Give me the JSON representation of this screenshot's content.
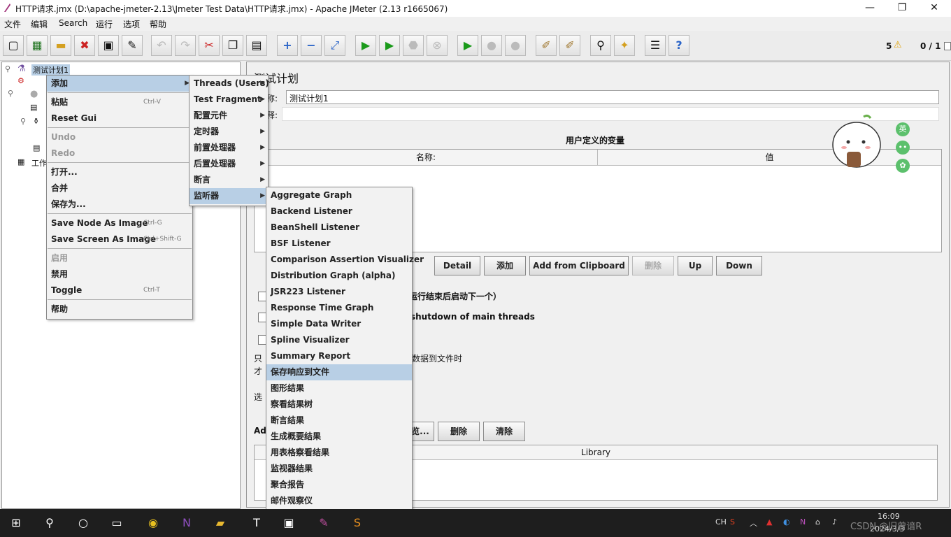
{
  "window": {
    "title": "HTTP请求.jmx (D:\\apache-jmeter-2.13\\Jmeter Test Data\\HTTP请求.jmx) - Apache JMeter (2.13 r1665067)",
    "minimize": "—",
    "maximize": "❐",
    "close": "✕"
  },
  "menubar": [
    "文件",
    "编辑",
    "Search",
    "运行",
    "选项",
    "帮助"
  ],
  "status": {
    "warnings": "5",
    "threads": "0 / 1"
  },
  "tree": {
    "root": "测试计划1",
    "workbench_partial": "工作"
  },
  "context_menu": {
    "items": [
      {
        "label": "添加",
        "shortcut": ""
      },
      {
        "label": "粘贴",
        "shortcut": "Ctrl-V"
      },
      {
        "label": "Reset Gui",
        "shortcut": ""
      },
      {
        "label": "Undo",
        "shortcut": ""
      },
      {
        "label": "Redo",
        "shortcut": ""
      },
      {
        "label": "打开...",
        "shortcut": ""
      },
      {
        "label": "合并",
        "shortcut": ""
      },
      {
        "label": "保存为...",
        "shortcut": ""
      },
      {
        "label": "Save Node As Image",
        "shortcut": "Ctrl-G"
      },
      {
        "label": "Save Screen As Image",
        "shortcut": "Ctrl+Shift-G"
      },
      {
        "label": "启用",
        "shortcut": ""
      },
      {
        "label": "禁用",
        "shortcut": ""
      },
      {
        "label": "Toggle",
        "shortcut": "Ctrl-T"
      },
      {
        "label": "帮助",
        "shortcut": ""
      }
    ]
  },
  "add_submenu": {
    "items": [
      "Threads (Users)",
      "Test Fragment",
      "配置元件",
      "定时器",
      "前置处理器",
      "后置处理器",
      "断言",
      "监听器"
    ]
  },
  "listener_submenu": {
    "items": [
      "Aggregate Graph",
      "Backend Listener",
      "BeanShell Listener",
      "BSF Listener",
      "Comparison Assertion Visualizer",
      "Distribution Graph (alpha)",
      "JSR223 Listener",
      "Response Time Graph",
      "Simple Data Writer",
      "Spline Visualizer",
      "Summary Report",
      "保存响应到文件",
      "图形结果",
      "察看结果树",
      "断言结果",
      "生成概要结果",
      "用表格察看结果",
      "监视器结果",
      "聚合报告",
      "邮件观察仪"
    ]
  },
  "panel": {
    "heading": "测试计划",
    "name_label": "称:",
    "name_value": "测试计划1",
    "comment_label": "释:",
    "vars_title": "用户定义的变量",
    "col_name": "名称:",
    "col_value": "值",
    "buttons": [
      "Detail",
      "添加",
      "Add from Clipboard",
      "删除",
      "Up",
      "Down"
    ],
    "option1_tail": "运行结束后启动下一个）",
    "option2_tail": "shutdown of main threads",
    "text1_head": "只",
    "text1_tail": "数据到文件时",
    "text2_head": "才",
    "select_head": "选",
    "add_head": "Ad",
    "browse_tail": "览...",
    "lib_delete": "删除",
    "lib_clear": "清除",
    "library_col": "Library"
  },
  "taskbar": {
    "lang": "CH",
    "ime": "英",
    "time": "16:09",
    "date": "2024/3/3",
    "watermark": "CSDN @旧曾谙R"
  },
  "colors": {
    "selection": "#b8cfe5",
    "menu_bg": "#f2f2f2",
    "taskbar": "#1e1e1e",
    "run_green": "#1a9a1a"
  }
}
